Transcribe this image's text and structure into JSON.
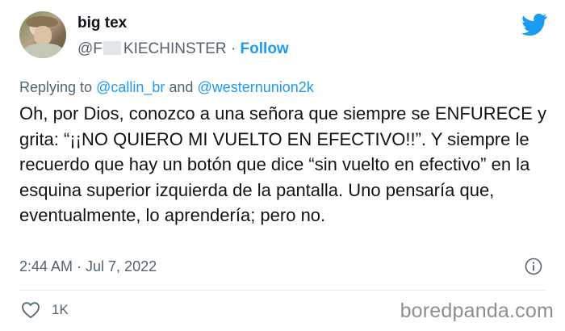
{
  "author": {
    "display_name": "big tex",
    "handle_prefix": "@F",
    "handle_suffix": "KIECHINSTER",
    "separator": "·",
    "follow_label": "Follow"
  },
  "reply": {
    "prefix": "Replying to",
    "mention1": "@callin_br",
    "conjunction": "and",
    "mention2": "@westernunion2k"
  },
  "tweet": {
    "text": "Oh, por Dios, conozco a una señora que siempre se ENFURECE y grita: “¡¡NO QUIERO MI VUELTO EN EFECTIVO!!”. Y siempre le recuerdo que hay un botón que dice “sin vuelto en efectivo” en la esquina superior izquierda de la pantalla. Uno pensaría que, eventualmente, lo aprendería; pero no."
  },
  "meta": {
    "timestamp": "2:44 AM · Jul 7, 2022"
  },
  "engagement": {
    "likes": "1K"
  },
  "watermark": "boredpanda.com",
  "colors": {
    "accent": "#1d9bf0",
    "muted": "#536471",
    "text": "#0f1419"
  },
  "icons": [
    "twitter-bird-icon",
    "info-icon",
    "heart-icon"
  ]
}
